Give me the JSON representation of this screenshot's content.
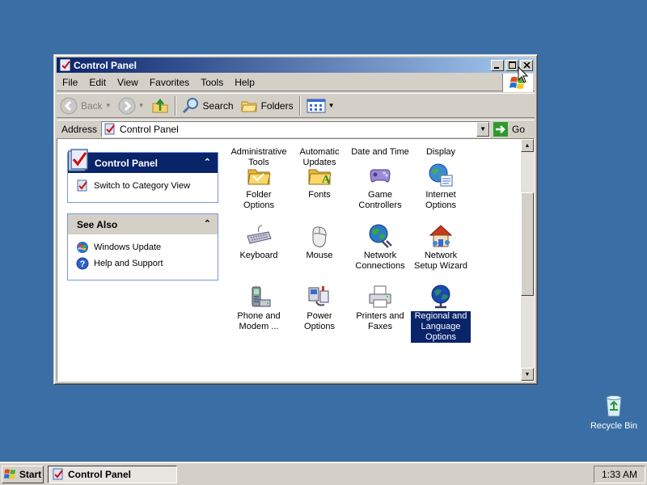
{
  "window": {
    "title": "Control Panel",
    "menu": [
      "File",
      "Edit",
      "View",
      "Favorites",
      "Tools",
      "Help"
    ],
    "toolbar": {
      "back": "Back",
      "search": "Search",
      "folders": "Folders"
    },
    "address": {
      "label": "Address",
      "value": "Control Panel",
      "go": "Go"
    }
  },
  "taskpane": {
    "control_panel": {
      "title": "Control Panel",
      "link": "Switch to Category View"
    },
    "see_also": {
      "title": "See Also",
      "links": [
        "Windows Update",
        "Help and Support"
      ]
    }
  },
  "icons": [
    {
      "label": "Administrative Tools",
      "icon": "admin-tools-icon"
    },
    {
      "label": "Automatic Updates",
      "icon": "auto-updates-icon"
    },
    {
      "label": "Date and Time",
      "icon": "date-time-icon"
    },
    {
      "label": "Display",
      "icon": "display-icon"
    },
    {
      "label": "Folder Options",
      "icon": "folder-options-icon"
    },
    {
      "label": "Fonts",
      "icon": "fonts-icon"
    },
    {
      "label": "Game Controllers",
      "icon": "game-controllers-icon"
    },
    {
      "label": "Internet Options",
      "icon": "internet-options-icon"
    },
    {
      "label": "Keyboard",
      "icon": "keyboard-icon"
    },
    {
      "label": "Mouse",
      "icon": "mouse-icon"
    },
    {
      "label": "Network Connections",
      "icon": "network-connections-icon"
    },
    {
      "label": "Network Setup Wizard",
      "icon": "network-setup-icon"
    },
    {
      "label": "Phone and Modem ...",
      "icon": "phone-modem-icon"
    },
    {
      "label": "Power Options",
      "icon": "power-options-icon"
    },
    {
      "label": "Printers and Faxes",
      "icon": "printers-icon"
    },
    {
      "label": "Regional and Language Options",
      "icon": "regional-icon",
      "selected": true
    }
  ],
  "desktop": {
    "recycle_bin": "Recycle Bin"
  },
  "taskbar": {
    "start": "Start",
    "task": "Control Panel",
    "clock": "1:33 AM"
  }
}
